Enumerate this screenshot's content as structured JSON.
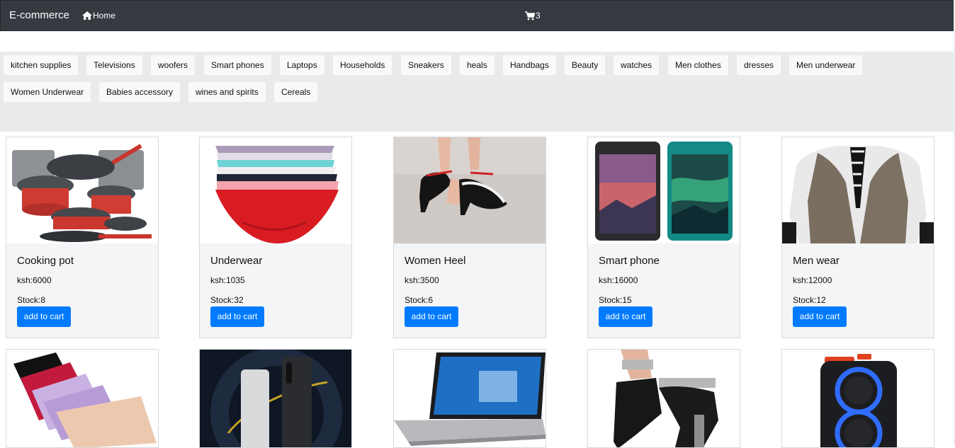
{
  "navbar": {
    "brand": "E-commerce",
    "home_label": "Home",
    "cart_count": "3"
  },
  "categories": [
    "kitchen supplies",
    "Televisions",
    "woofers",
    "Smart phones",
    "Laptops",
    "Households",
    "Sneakers",
    "heals",
    "Handbags",
    "Beauty",
    "watches",
    "Men clothes",
    "dresses",
    "Men underwear",
    "Women Underwear",
    "Babies accessory",
    "wines and spirits",
    "Cereals"
  ],
  "products": [
    {
      "title": "Cooking pot",
      "price": "ksh:6000",
      "stock": "Stock:8",
      "button": "add to cart",
      "image": "cooking-pots-image"
    },
    {
      "title": "Underwear",
      "price": "ksh:1035",
      "stock": "Stock:32",
      "button": "add to cart",
      "image": "underwear-image"
    },
    {
      "title": "Women Heel",
      "price": "ksh:3500",
      "stock": "Stock:6",
      "button": "add to cart",
      "image": "heels-image"
    },
    {
      "title": "Smart phone",
      "price": "ksh:16000",
      "stock": "Stock:15",
      "button": "add to cart",
      "image": "smartphones-image"
    },
    {
      "title": "Men wear",
      "price": "ksh:12000",
      "stock": "Stock:12",
      "button": "add to cart",
      "image": "vest-image"
    },
    {
      "image": "panties-image"
    },
    {
      "image": "phone-image"
    },
    {
      "image": "laptop-image"
    },
    {
      "image": "heels-image"
    },
    {
      "image": "speaker-image"
    }
  ],
  "colors": {
    "navbar": "#343a40",
    "primary_button": "#007bff",
    "category_bar": "#e9eaeb"
  }
}
